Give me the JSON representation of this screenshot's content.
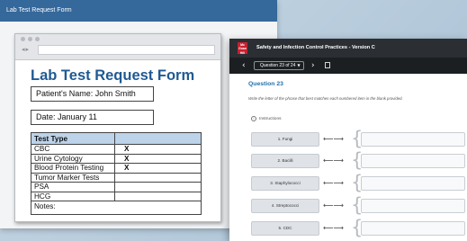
{
  "left_window": {
    "title": "Lab Test Request Form",
    "form": {
      "heading": "Lab Test Request Form",
      "patient": "Patient's Name:  John Smith",
      "date": "Date: January 11",
      "table": {
        "header": [
          "Test Type",
          ""
        ],
        "rows": [
          [
            "CBC",
            "X"
          ],
          [
            "Urine Cytology",
            "X"
          ],
          [
            "Blood Protein Testing",
            "X"
          ],
          [
            "Tumor Marker Tests",
            ""
          ],
          [
            "PSA",
            ""
          ],
          [
            "HCG",
            ""
          ]
        ],
        "notes_label": "Notes:"
      }
    }
  },
  "right_window": {
    "title": "Safety and Infection Control Practices - Version C",
    "question_selector": "Question 23 of 24",
    "question_title": "Question 23",
    "prompt": "Write the letter of the phrase that best matches each numbered item in the blank provided.",
    "instructions_label": "Instructions",
    "items": [
      {
        "label": "1. Fungi",
        "answer": ""
      },
      {
        "label": "2. Bacilli",
        "answer": ""
      },
      {
        "label": "3. Staphylococci",
        "answer": ""
      },
      {
        "label": "4. Streptococci",
        "answer": ""
      },
      {
        "label": "5. CDC",
        "answer": ""
      }
    ],
    "accent_color": "#1e6fa8",
    "brand_color": "#c8202f",
    "logo_text": [
      "Mc",
      "Graw",
      "Hill"
    ]
  },
  "icons": {
    "prev": "chevron-left-icon",
    "next": "chevron-right-icon",
    "bookmark": "bookmark-icon",
    "info": "info-icon",
    "arrow": "double-arrow-icon",
    "caret": "caret-down-icon"
  }
}
